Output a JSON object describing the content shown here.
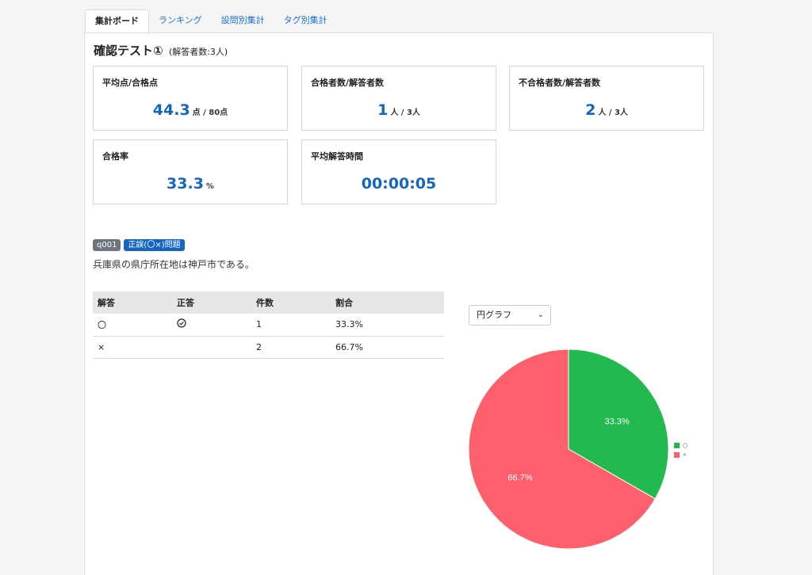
{
  "tabs": [
    "集計ボード",
    "ランキング",
    "設問別集計",
    "タグ別集計"
  ],
  "title": "確認テスト①",
  "respondents": "(解答者数:3人)",
  "cards": {
    "avg": {
      "label": "平均点/合格点",
      "value": "44.3",
      "unit": "点 / 80点"
    },
    "pass": {
      "label": "合格者数/解答者数",
      "value": "1",
      "unit": "人 / 3人"
    },
    "fail": {
      "label": "不合格者数/解答者数",
      "value": "2",
      "unit": "人 / 3人"
    },
    "rate": {
      "label": "合格率",
      "value": "33.3",
      "unit": "%"
    },
    "time": {
      "label": "平均解答時間",
      "value": "00:00:05"
    }
  },
  "question": {
    "id": "q001",
    "type": "正誤(〇×)問題",
    "text": "兵庫県の県庁所在地は神戸市である。"
  },
  "table": {
    "headers": [
      "解答",
      "正答",
      "件数",
      "割合"
    ],
    "rows": [
      {
        "answer": "〇",
        "correct": "check-circle-icon",
        "count": "1",
        "ratio": "33.3%"
      },
      {
        "answer": "×",
        "correct": "",
        "count": "2",
        "ratio": "66.7%"
      }
    ]
  },
  "chart_select": "円グラフ",
  "chart_data": {
    "type": "pie",
    "categories": [
      "〇",
      "×"
    ],
    "values": [
      33.3,
      66.7
    ],
    "labels": [
      "33.3%",
      "66.7%"
    ],
    "colors": [
      "#22b94f",
      "#fd5f6b"
    ],
    "legend": "right"
  }
}
